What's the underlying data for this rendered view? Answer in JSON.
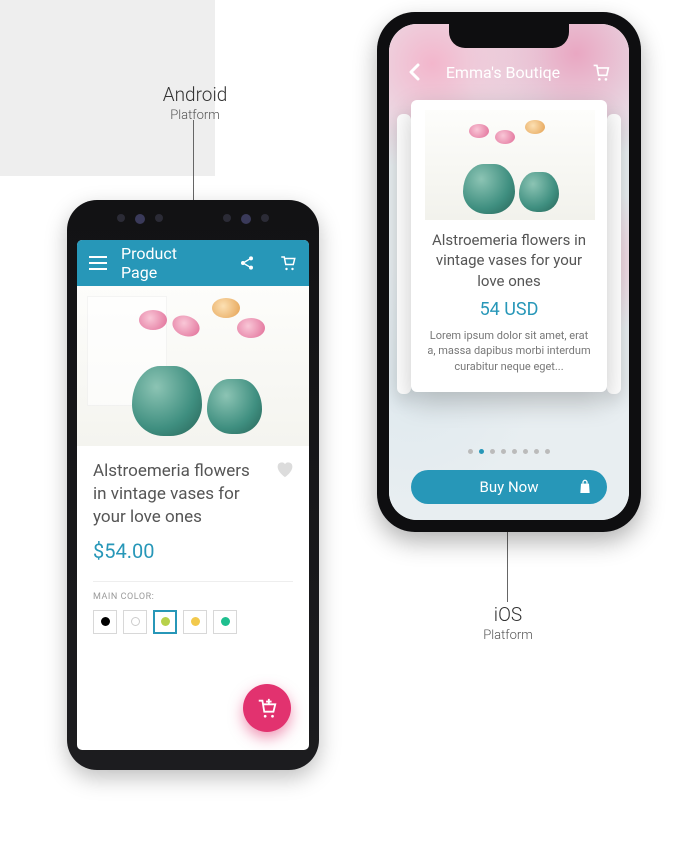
{
  "labels": {
    "android": {
      "title": "Android",
      "subtitle": "Platform"
    },
    "ios": {
      "title": "iOS",
      "subtitle": "Platform"
    }
  },
  "android": {
    "appbar": {
      "title": "Product Page"
    },
    "product": {
      "title": "Alstroemeria flowers in vintage vases for your love ones",
      "price": "$54.00",
      "color_label": "MAIN COLOR:",
      "swatches": [
        {
          "color": "#000000",
          "selected": false
        },
        {
          "color": "#ffffff",
          "selected": false
        },
        {
          "color": "#b7d14b",
          "selected": true
        },
        {
          "color": "#f2c94c",
          "selected": false
        },
        {
          "color": "#1fbf8f",
          "selected": false
        }
      ]
    }
  },
  "ios": {
    "header": {
      "title": "Emma's Boutiqe"
    },
    "product": {
      "title": "Alstroemeria flowers in vintage vases for your love ones",
      "price": "54 USD",
      "desc": "Lorem ipsum dolor sit amet, erat a, massa dapibus morbi interdum curabitur neque eget..."
    },
    "pager": {
      "count": 8,
      "active_index": 1
    },
    "buy_label": "Buy Now"
  },
  "colors": {
    "accent": "#2797b8",
    "fab": "#e2326f"
  }
}
